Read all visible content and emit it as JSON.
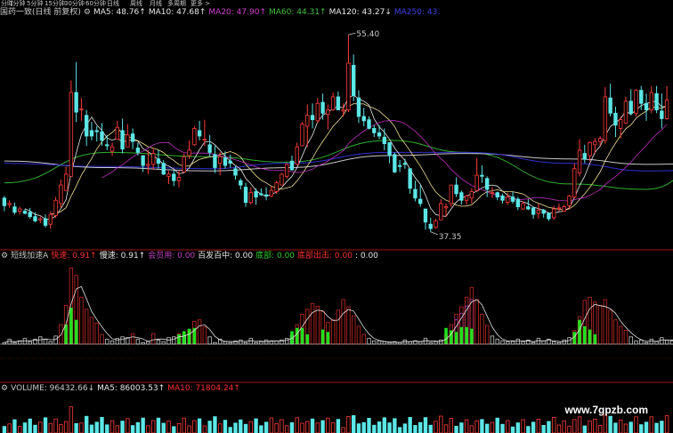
{
  "toolbar": {
    "items": [
      "分时",
      "1分钟",
      "5分钟",
      "15分钟",
      "30分钟",
      "60分钟",
      "日线",
      "周线",
      "月线",
      "多周期",
      "更多 >"
    ]
  },
  "price_header": {
    "title": "国药一致(日线 前复权)",
    "ma": [
      {
        "label": "MA5: 48.76↑",
        "color": "#e8e8e8"
      },
      {
        "label": "MA10: 47.68↑",
        "color": "#e8e8e8"
      },
      {
        "label": "MA20: 47.90↑",
        "color": "#d040d0"
      },
      {
        "label": "MA60: 44.31↑",
        "color": "#40c040"
      },
      {
        "label": "MA120: 43.27↓",
        "color": "#e8e8e8"
      },
      {
        "label": "MA250: 43.",
        "color": "#4040e0"
      }
    ]
  },
  "price_annotations": {
    "high": "55.40",
    "low": "37.35"
  },
  "indicator_header": {
    "title": "短线加速A",
    "items": [
      {
        "label": "快速: 0.91↑",
        "color": "#ff3030"
      },
      {
        "label": "慢速: 0.91↑",
        "color": "#e8e8e8"
      },
      {
        "label": "会员用: 0.00",
        "color": "#c040c0"
      },
      {
        "label": "百发百中: 0.00",
        "color": "#e8e8e8"
      },
      {
        "label": "底部: 0.00",
        "color": "#30d030"
      },
      {
        "label": "底部出击: 0.00",
        "color": "#ff3030"
      },
      {
        "label": ": 0.00",
        "color": "#e8e8e8"
      }
    ]
  },
  "volume_header": {
    "title": "VOLUME: 96432.66↓",
    "items": [
      {
        "label": "MA5: 86003.53↑",
        "color": "#e8e8e8"
      },
      {
        "label": "MA10: 71804.24↑",
        "color": "#ff3030"
      }
    ]
  },
  "watermark": "www.7gpzb.com",
  "colors": {
    "up": "#ff3c3c",
    "down": "#5ce6e6",
    "grid": "#a01010",
    "ma250": "#3030d0",
    "ma60": "#30b030",
    "ma20": "#c030c0",
    "ma10": "#e0e0e0",
    "green_bar": "#20e020",
    "purple_bar": "#9040c0"
  },
  "chart_data": {
    "type": "candlestick",
    "ohlc": [
      [
        40.4,
        40.6,
        39.2,
        39.7
      ],
      [
        39.8,
        40.2,
        39.5,
        39.9
      ],
      [
        39.6,
        40.0,
        38.9,
        39.1
      ],
      [
        39.2,
        39.6,
        38.9,
        39.4
      ],
      [
        39.2,
        39.4,
        38.9,
        39.0
      ],
      [
        39.1,
        39.5,
        38.5,
        38.7
      ],
      [
        38.7,
        39.1,
        38.2,
        38.3
      ],
      [
        38.4,
        38.7,
        38.1,
        38.5
      ],
      [
        38.5,
        38.9,
        37.7,
        37.9
      ],
      [
        38.0,
        39.2,
        37.6,
        38.9
      ],
      [
        38.8,
        40.5,
        38.6,
        40.2
      ],
      [
        39.9,
        42.1,
        39.5,
        41.6
      ],
      [
        41.1,
        43.3,
        41.1,
        42.6
      ],
      [
        42.4,
        51.2,
        42.4,
        50.1
      ],
      [
        50.1,
        52.9,
        47.4,
        48.3
      ],
      [
        48.5,
        49.6,
        47.5,
        48.6
      ],
      [
        48.0,
        48.5,
        45.2,
        46.1
      ],
      [
        46.6,
        47.4,
        45.7,
        46.1
      ],
      [
        46.6,
        47.0,
        45.6,
        46.5
      ],
      [
        46.5,
        47.3,
        45.2,
        45.7
      ],
      [
        45.3,
        46.2,
        44.8,
        45.2
      ],
      [
        44.7,
        45.5,
        44.3,
        45.1
      ],
      [
        45.8,
        47.5,
        45.8,
        46.9
      ],
      [
        46.6,
        47.7,
        44.5,
        44.9
      ],
      [
        45.1,
        47.2,
        45.1,
        46.2
      ],
      [
        46.3,
        46.8,
        44.9,
        45.6
      ],
      [
        45.0,
        45.5,
        44.3,
        44.6
      ],
      [
        44.3,
        44.3,
        42.8,
        43.4
      ],
      [
        43.4,
        44.8,
        42.6,
        43.5
      ],
      [
        43.5,
        45.0,
        43.0,
        44.5
      ],
      [
        44.0,
        44.8,
        43.1,
        43.6
      ],
      [
        43.6,
        43.9,
        42.5,
        42.6
      ],
      [
        42.4,
        42.9,
        41.7,
        42.6
      ],
      [
        42.6,
        43.0,
        41.5,
        42.0
      ],
      [
        42.0,
        42.9,
        41.4,
        42.3
      ],
      [
        42.8,
        44.5,
        42.8,
        44.2
      ],
      [
        44.3,
        45.7,
        44.0,
        44.8
      ],
      [
        45.3,
        47.0,
        45.2,
        46.8
      ],
      [
        46.6,
        47.5,
        45.7,
        46.1
      ],
      [
        45.8,
        47.6,
        45.2,
        45.8
      ],
      [
        45.3,
        46.2,
        44.2,
        44.6
      ],
      [
        44.4,
        45.2,
        42.7,
        43.2
      ],
      [
        43.6,
        44.6,
        42.5,
        44.2
      ],
      [
        44.1,
        44.7,
        43.1,
        43.4
      ],
      [
        43.8,
        44.4,
        43.2,
        43.6
      ],
      [
        43.1,
        43.4,
        42.1,
        42.5
      ],
      [
        42.0,
        42.2,
        41.2,
        41.6
      ],
      [
        41.4,
        41.8,
        39.6,
        40.0
      ],
      [
        40.0,
        41.4,
        39.8,
        40.9
      ],
      [
        41.0,
        41.3,
        39.8,
        40.5
      ],
      [
        40.8,
        41.3,
        40.6,
        40.7
      ],
      [
        40.7,
        41.4,
        40.2,
        40.6
      ],
      [
        40.6,
        41.5,
        40.5,
        41.1
      ],
      [
        41.0,
        42.0,
        40.8,
        41.8
      ],
      [
        41.6,
        42.7,
        41.6,
        42.6
      ],
      [
        42.4,
        43.6,
        42.2,
        43.5
      ],
      [
        43.8,
        44.3,
        42.9,
        43.0
      ],
      [
        43.5,
        45.5,
        43.4,
        45.1
      ],
      [
        45.2,
        47.4,
        45.2,
        47.2
      ],
      [
        47.0,
        49.0,
        45.1,
        48.0
      ],
      [
        48.0,
        49.1,
        46.8,
        47.6
      ],
      [
        47.5,
        49.6,
        47.3,
        49.1
      ],
      [
        49.2,
        50.0,
        47.6,
        48.2
      ],
      [
        48.1,
        49.0,
        46.7,
        48.5
      ],
      [
        48.5,
        50.1,
        48.4,
        49.7
      ],
      [
        49.7,
        50.2,
        48.5,
        48.5
      ],
      [
        48.4,
        49.1,
        47.9,
        48.5
      ],
      [
        48.5,
        55.4,
        48.3,
        52.8
      ],
      [
        52.6,
        53.6,
        49.3,
        49.8
      ],
      [
        49.6,
        50.3,
        47.3,
        47.9
      ],
      [
        47.9,
        48.7,
        47.0,
        47.5
      ],
      [
        47.6,
        47.9,
        46.7,
        46.8
      ],
      [
        46.8,
        47.1,
        46.0,
        46.4
      ],
      [
        46.4,
        47.1,
        45.8,
        46.1
      ],
      [
        46.0,
        46.8,
        44.8,
        45.4
      ],
      [
        45.5,
        45.5,
        43.6,
        44.3
      ],
      [
        44.4,
        44.6,
        42.7,
        42.8
      ],
      [
        43.4,
        43.9,
        42.8,
        43.3
      ],
      [
        43.6,
        44.0,
        43.1,
        43.5
      ],
      [
        43.1,
        43.1,
        40.8,
        41.3
      ],
      [
        41.2,
        42.0,
        40.1,
        40.4
      ],
      [
        40.3,
        41.6,
        39.6,
        39.9
      ],
      [
        39.4,
        39.4,
        37.5,
        38.2
      ],
      [
        38.0,
        38.6,
        37.3,
        37.6
      ],
      [
        37.7,
        38.5,
        37.6,
        38.3
      ],
      [
        38.4,
        40.3,
        38.4,
        39.9
      ],
      [
        39.5,
        39.9,
        38.7,
        39.6
      ],
      [
        39.9,
        41.6,
        39.6,
        41.6
      ],
      [
        41.6,
        42.3,
        40.5,
        40.8
      ],
      [
        40.9,
        41.1,
        39.8,
        40.2
      ],
      [
        40.2,
        40.7,
        39.8,
        40.6
      ],
      [
        40.4,
        41.3,
        39.9,
        41.0
      ],
      [
        41.1,
        44.1,
        41.0,
        42.5
      ],
      [
        42.5,
        43.4,
        41.8,
        42.4
      ],
      [
        42.2,
        42.4,
        40.5,
        41.2
      ],
      [
        40.9,
        41.4,
        40.4,
        40.9
      ],
      [
        40.9,
        41.0,
        40.2,
        40.5
      ],
      [
        40.6,
        40.8,
        39.9,
        40.2
      ],
      [
        40.0,
        40.9,
        39.8,
        40.5
      ],
      [
        40.5,
        41.0,
        39.9,
        40.1
      ],
      [
        40.3,
        40.5,
        39.3,
        39.6
      ],
      [
        39.4,
        40.1,
        39.3,
        39.9
      ],
      [
        39.6,
        40.3,
        39.3,
        39.4
      ],
      [
        39.5,
        39.6,
        38.5,
        38.9
      ],
      [
        39.0,
        39.9,
        38.5,
        39.3
      ],
      [
        39.3,
        39.4,
        38.6,
        39.0
      ],
      [
        39.0,
        39.1,
        38.3,
        38.5
      ],
      [
        38.6,
        39.7,
        38.4,
        39.4
      ],
      [
        39.5,
        39.9,
        39.2,
        39.5
      ],
      [
        39.2,
        39.8,
        39.2,
        39.6
      ],
      [
        39.7,
        40.7,
        39.4,
        40.6
      ],
      [
        40.5,
        43.6,
        40.4,
        43.1
      ],
      [
        42.7,
        45.8,
        42.4,
        44.8
      ],
      [
        44.5,
        45.3,
        43.6,
        44.0
      ],
      [
        44.3,
        45.6,
        43.8,
        45.5
      ],
      [
        45.3,
        45.9,
        44.5,
        45.6
      ],
      [
        45.6,
        46.1,
        45.2,
        45.9
      ],
      [
        45.7,
        50.6,
        45.4,
        49.7
      ],
      [
        49.6,
        50.9,
        47.9,
        48.2
      ],
      [
        48.2,
        48.8,
        46.0,
        47.1
      ],
      [
        46.8,
        47.9,
        45.9,
        47.6
      ],
      [
        47.3,
        49.7,
        47.2,
        49.3
      ],
      [
        49.3,
        50.4,
        48.0,
        48.2
      ],
      [
        48.2,
        50.4,
        47.9,
        50.3
      ],
      [
        50.3,
        50.7,
        48.5,
        49.1
      ],
      [
        49.1,
        50.0,
        47.5,
        48.5
      ],
      [
        48.5,
        50.7,
        48.2,
        50.1
      ],
      [
        50.0,
        50.7,
        48.2,
        48.5
      ],
      [
        48.4,
        50.0,
        46.8,
        47.7
      ],
      [
        47.7,
        50.7,
        47.6,
        49.4
      ]
    ],
    "price_ylim": [
      36.3,
      56.8
    ],
    "moving_averages": [
      {
        "name": "MA60",
        "color": "#30b030",
        "points": [
          [
            0,
            41.8
          ],
          [
            20,
            44.6
          ],
          [
            40,
            44.2
          ],
          [
            55,
            43.7
          ],
          [
            75,
            45.7
          ],
          [
            90,
            44.6
          ],
          [
            110,
            41.7
          ],
          [
            125,
            41.2
          ],
          [
            139,
            44.3
          ]
        ]
      },
      {
        "name": "MA120",
        "color": "#c8c8c8",
        "points": [
          [
            0,
            43.8
          ],
          [
            20,
            43.2
          ],
          [
            40,
            42.9
          ],
          [
            55,
            43.2
          ],
          [
            75,
            44.3
          ],
          [
            90,
            44.5
          ],
          [
            110,
            44.0
          ],
          [
            125,
            43.5
          ],
          [
            139,
            43.6
          ]
        ]
      },
      {
        "name": "MA250",
        "color": "#3030d0",
        "points": [
          [
            0,
            43.6
          ],
          [
            20,
            43.3
          ],
          [
            40,
            43.1
          ],
          [
            55,
            43.6
          ],
          [
            75,
            44.6
          ],
          [
            90,
            44.6
          ],
          [
            110,
            43.6
          ],
          [
            125,
            42.9
          ],
          [
            139,
            43.0
          ]
        ]
      }
    ],
    "indicator": {
      "ylim": [
        0,
        1
      ],
      "red": [
        0.02,
        0.06,
        0.02,
        0.04,
        0.07,
        0.03,
        0.06,
        0.09,
        0.06,
        0.03,
        0.1,
        0.24,
        0.48,
        0.94,
        0.85,
        0.58,
        0.43,
        0.33,
        0.26,
        0.12,
        0.06,
        0.04,
        0.07,
        0.09,
        0.08,
        0.13,
        0.06,
        0.02,
        0.03,
        0.13,
        0.05,
        0.03,
        0.08,
        0.09,
        0.13,
        0.11,
        0.17,
        0.28,
        0.3,
        0.21,
        0.09,
        0.02,
        0.06,
        0.03,
        0.02,
        0.04,
        0.05,
        0.02,
        0.07,
        0.02,
        0.03,
        0.05,
        0.04,
        0.04,
        0.05,
        0.07,
        0.11,
        0.24,
        0.37,
        0.43,
        0.5,
        0.47,
        0.4,
        0.27,
        0.3,
        0.42,
        0.55,
        0.46,
        0.35,
        0.22,
        0.12,
        0.07,
        0.04,
        0.04,
        0.03,
        0.02,
        0.03,
        0.02,
        0.05,
        0.03,
        0.04,
        0.03,
        0.07,
        0.02,
        0.03,
        0.05,
        0.12,
        0.24,
        0.37,
        0.46,
        0.58,
        0.7,
        0.55,
        0.37,
        0.23,
        0.1,
        0.06,
        0.04,
        0.03,
        0.04,
        0.06,
        0.03,
        0.05,
        0.02,
        0.07,
        0.04,
        0.06,
        0.03,
        0.02,
        0.05,
        0.08,
        0.17,
        0.34,
        0.54,
        0.58,
        0.52,
        0.48,
        0.55,
        0.42,
        0.3,
        0.22,
        0.17,
        0.09,
        0.04,
        0.05,
        0.02,
        0.06,
        0.03,
        0.08,
        0.05,
        0.04,
        0.07,
        0.04,
        0.02,
        0.05,
        0.03,
        0.04,
        0.09,
        0.04,
        0.55
      ],
      "green": [
        0,
        0,
        0,
        0,
        0,
        0,
        0,
        0,
        0,
        0,
        0,
        0,
        0.24,
        0.45,
        0.3,
        0,
        0,
        0,
        0,
        0,
        0,
        0,
        0,
        0,
        0,
        0,
        0,
        0,
        0,
        0,
        0,
        0,
        0,
        0,
        0.12,
        0.16,
        0.19,
        0.2,
        0,
        0,
        0,
        0,
        0,
        0,
        0,
        0,
        0,
        0,
        0,
        0,
        0,
        0,
        0,
        0,
        0,
        0,
        0.16,
        0.2,
        0.2,
        0.12,
        0,
        0,
        0.18,
        0.15,
        0,
        0,
        0,
        0,
        0,
        0,
        0,
        0,
        0,
        0,
        0,
        0,
        0,
        0,
        0,
        0,
        0,
        0,
        0,
        0,
        0,
        0,
        0.2,
        0.17,
        0.15,
        0.21,
        0.21,
        0.19,
        0,
        0,
        0,
        0,
        0,
        0,
        0,
        0,
        0,
        0,
        0,
        0,
        0,
        0,
        0,
        0,
        0,
        0,
        0,
        0.15,
        0.3,
        0.22,
        0.18,
        0.12,
        0,
        0,
        0,
        0,
        0,
        0,
        0,
        0,
        0,
        0,
        0,
        0,
        0,
        0,
        0,
        0,
        0,
        0,
        0,
        0,
        0,
        0,
        0.19,
        0.37
      ],
      "purple": [
        0,
        0,
        0,
        0,
        0,
        0,
        0,
        0,
        0,
        0,
        0,
        0,
        0,
        0,
        0,
        0,
        0,
        0,
        0,
        0,
        0,
        0,
        0,
        0,
        0,
        0,
        0,
        0,
        0,
        0,
        0,
        0,
        0,
        0,
        0,
        0,
        0,
        0,
        0,
        0,
        0,
        0,
        0,
        0,
        0,
        0,
        0,
        0,
        0,
        0,
        0,
        0,
        0,
        0,
        0,
        0,
        0,
        0,
        0,
        0,
        0,
        0,
        0,
        0,
        0,
        0,
        0,
        0,
        0,
        0,
        0,
        0,
        0,
        0,
        0,
        0,
        0,
        0,
        0,
        0,
        0,
        0,
        0,
        0,
        0,
        0,
        0,
        0,
        0.3,
        0.38,
        0.47,
        0.55,
        0,
        0,
        0,
        0,
        0,
        0,
        0,
        0,
        0,
        0,
        0,
        0,
        0,
        0,
        0,
        0,
        0,
        0,
        0,
        0,
        0,
        0,
        0,
        0,
        0,
        0,
        0,
        0,
        0,
        0,
        0,
        0,
        0,
        0,
        0,
        0,
        0,
        0,
        0,
        0,
        0,
        0,
        0,
        0,
        0,
        0
      ]
    }
  }
}
